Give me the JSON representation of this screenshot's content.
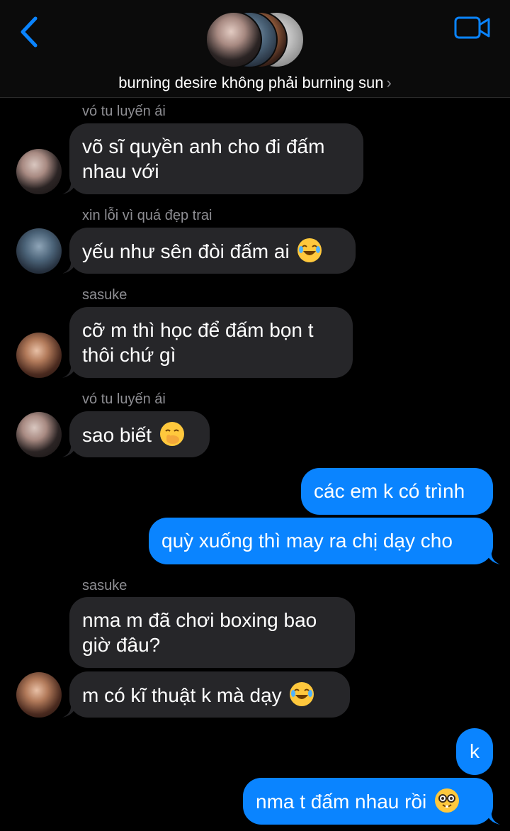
{
  "header": {
    "group_name": "burning desire không phải burning sun",
    "chevron": "›"
  },
  "messages": [
    {
      "sender": "vó tu luyến ái",
      "text_lines": [
        "võ sĩ quyền anh cho đi đấm",
        "nhau với"
      ]
    },
    {
      "sender": "xin lỗi vì quá đẹp trai",
      "text": "yếu như sên đòi đấm ai",
      "emoji": "face-with-tears-of-joy"
    },
    {
      "sender": "sasuke",
      "text_lines": [
        "cỡ m thì học để đấm bọn t",
        "thôi chứ gì"
      ]
    },
    {
      "sender": "vó tu luyến ái",
      "text": "sao biết",
      "emoji": "face-with-hand-over-mouth"
    },
    {
      "outgoing": true,
      "text": "các em k có trình"
    },
    {
      "outgoing": true,
      "text": "quỳ xuống thì may ra chị dạy cho"
    },
    {
      "sender": "sasuke",
      "text_lines": [
        "nma m đã chơi boxing bao",
        "giờ đâu?"
      ]
    },
    {
      "sender_continued": true,
      "text": "m có kĩ thuật k mà dạy",
      "emoji": "face-with-tears-of-joy"
    },
    {
      "outgoing": true,
      "text": "k"
    },
    {
      "outgoing": true,
      "text": "nma t đấm nhau rồi",
      "emoji": "nerd-face"
    }
  ],
  "colors": {
    "background": "#000000",
    "incoming_bubble": "#262629",
    "outgoing_bubble": "#0a84ff",
    "accent": "#0a84ff",
    "sender_label": "#8e8e93"
  },
  "icons": [
    "back-chevron-icon",
    "video-call-icon"
  ]
}
